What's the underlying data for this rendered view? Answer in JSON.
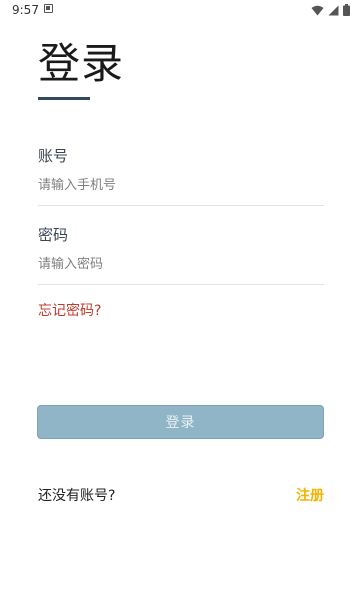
{
  "status_bar": {
    "time": "9:57",
    "notification_icon": "a-notification-icon",
    "wifi_icon": "wifi-icon",
    "signal_icon": "signal-icon",
    "battery_icon": "battery-icon"
  },
  "login": {
    "title": "登录",
    "account_label": "账号",
    "account_placeholder": "请输入手机号",
    "password_label": "密码",
    "password_placeholder": "请输入密码",
    "forgot_password": "忘记密码?",
    "login_button": "登录",
    "no_account_text": "还没有账号?",
    "register_link": "注册"
  },
  "colors": {
    "underline": "#34495e",
    "forgot": "#c0392b",
    "button_bg": "#8fb5c6",
    "register": "#f0b400"
  }
}
